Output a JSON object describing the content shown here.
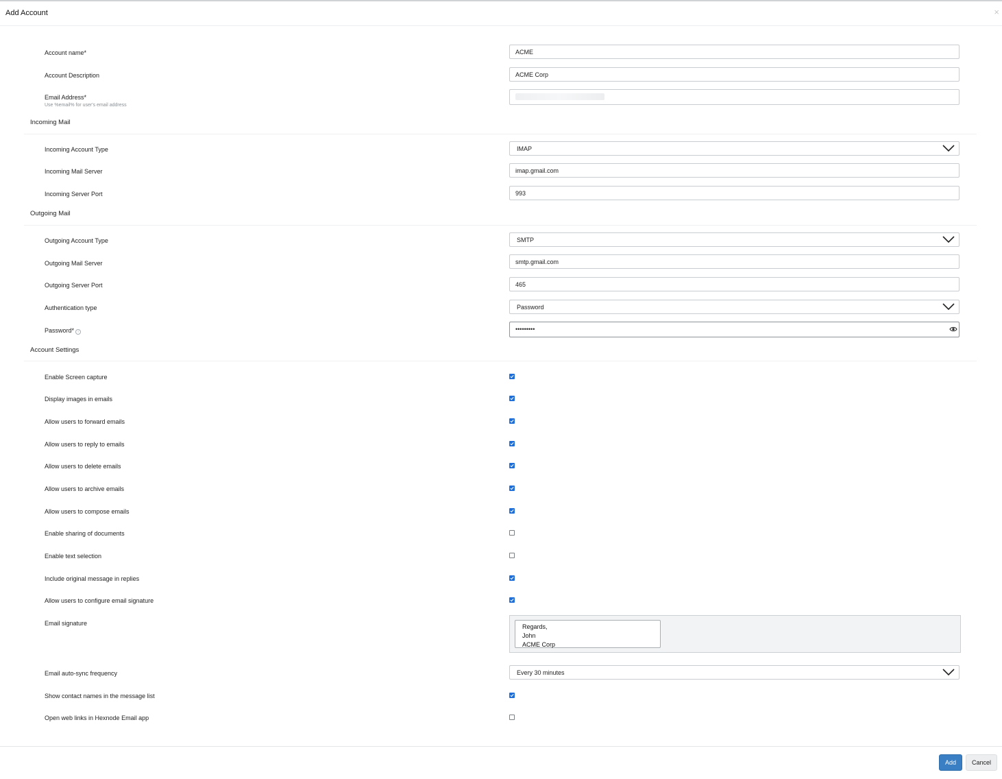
{
  "modal": {
    "title": "Add Account",
    "close_glyph": "×"
  },
  "general": {
    "account_name": {
      "label": "Account name*",
      "value": "ACME"
    },
    "account_description": {
      "label": "Account Description",
      "value": "ACME Corp"
    },
    "email_address": {
      "label": "Email Address*",
      "hint": "Use %email% for user's email address",
      "value": ""
    }
  },
  "incoming": {
    "section_title": "Incoming Mail",
    "account_type": {
      "label": "Incoming Account Type",
      "value": "IMAP"
    },
    "mail_server": {
      "label": "Incoming Mail Server",
      "value": "imap.gmail.com"
    },
    "server_port": {
      "label": "Incoming Server Port",
      "value": "993"
    }
  },
  "outgoing": {
    "section_title": "Outgoing Mail",
    "account_type": {
      "label": "Outgoing Account Type",
      "value": "SMTP"
    },
    "mail_server": {
      "label": "Outgoing Mail Server",
      "value": "smtp.gmail.com"
    },
    "server_port": {
      "label": "Outgoing Server Port",
      "value": "465"
    },
    "auth_type": {
      "label": "Authentication type",
      "value": "Password"
    },
    "password": {
      "label": "Password*",
      "info_glyph": "i",
      "masked_value": "•••••••••"
    }
  },
  "settings": {
    "section_title": "Account Settings",
    "items": [
      {
        "label": "Enable Screen capture",
        "checked": true
      },
      {
        "label": "Display images in emails",
        "checked": true
      },
      {
        "label": "Allow users to forward emails",
        "checked": true
      },
      {
        "label": "Allow users to reply to emails",
        "checked": true
      },
      {
        "label": "Allow users to delete emails",
        "checked": true
      },
      {
        "label": "Allow users to archive emails",
        "checked": true
      },
      {
        "label": "Allow users to compose emails",
        "checked": true
      },
      {
        "label": "Enable sharing of documents",
        "checked": false
      },
      {
        "label": "Enable text selection",
        "checked": false
      },
      {
        "label": "Include original message in replies",
        "checked": true
      },
      {
        "label": "Allow users to configure email signature",
        "checked": true
      }
    ],
    "email_signature": {
      "label": "Email signature",
      "lines": [
        "Regards,",
        "John",
        "ACME Corp"
      ]
    },
    "auto_sync": {
      "label": "Email auto-sync frequency",
      "value": "Every 30 minutes"
    },
    "show_contact_names": {
      "label": "Show contact names in the message list",
      "checked": true
    },
    "open_web_links": {
      "label": "Open web links in Hexnode Email app",
      "checked": false
    }
  },
  "footer": {
    "add_label": "Add",
    "cancel_label": "Cancel"
  },
  "colors": {
    "accent": "#3a7fc4",
    "checkbox": "#1e6fd9"
  }
}
